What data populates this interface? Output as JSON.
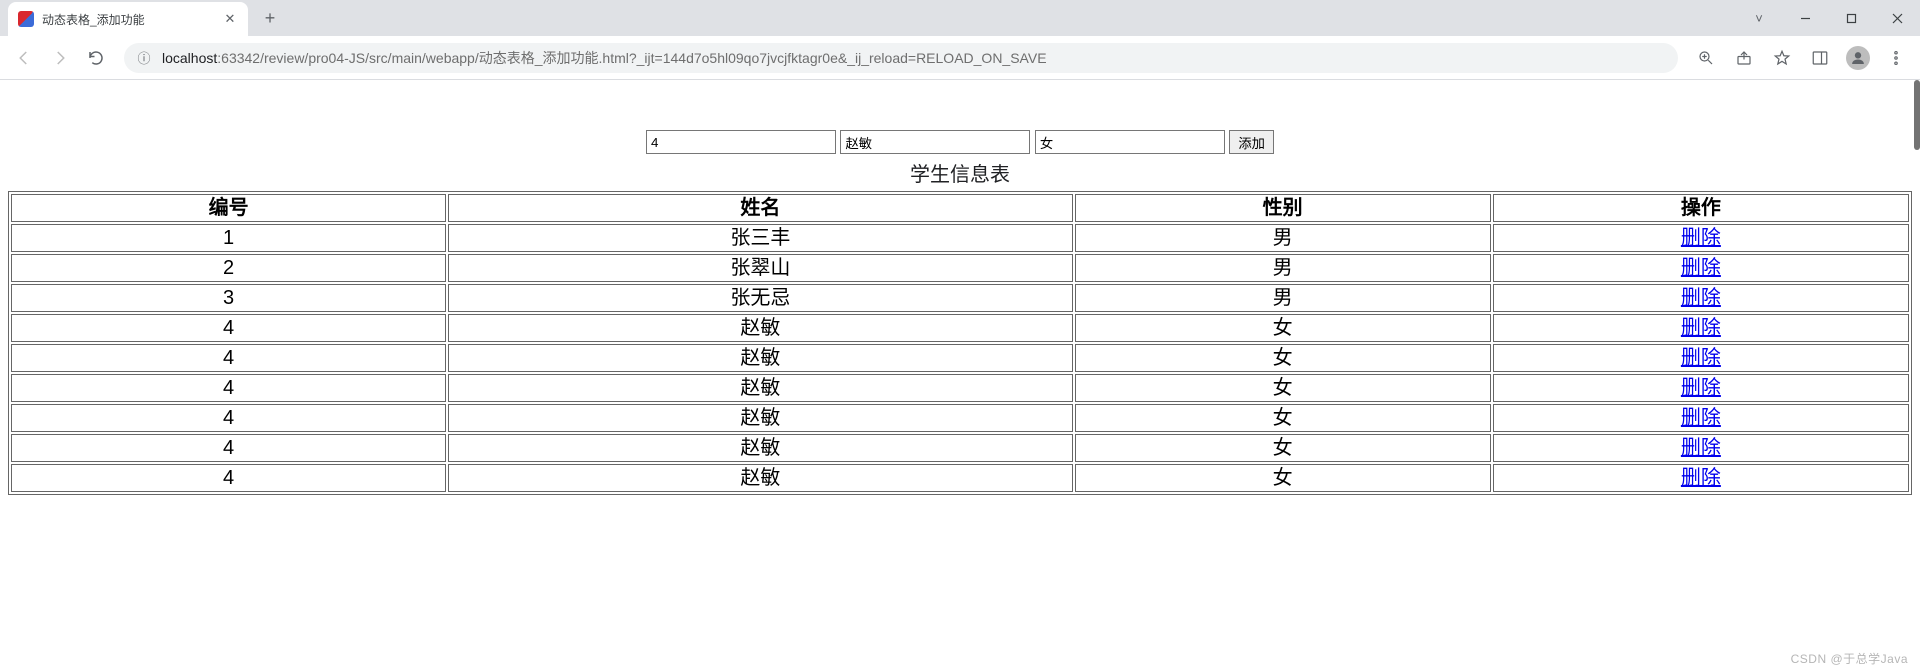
{
  "browser": {
    "tab_title": "动态表格_添加功能",
    "url_host": "localhost",
    "url_port_path": ":63342/review/pro04-JS/src/main/webapp/动态表格_添加功能.html?_ijt=144d7o5hl09qo7jvcjfktagr0e&_ij_reload=RELOAD_ON_SAVE"
  },
  "form": {
    "id_value": "4",
    "name_value": "赵敏",
    "gender_value": "女",
    "add_label": "添加"
  },
  "table": {
    "caption": "学生信息表",
    "headers": [
      "编号",
      "姓名",
      "性别",
      "操作"
    ],
    "delete_label": "删除",
    "rows": [
      {
        "id": "1",
        "name": "张三丰",
        "gender": "男"
      },
      {
        "id": "2",
        "name": "张翠山",
        "gender": "男"
      },
      {
        "id": "3",
        "name": "张无忌",
        "gender": "男"
      },
      {
        "id": "4",
        "name": "赵敏",
        "gender": "女"
      },
      {
        "id": "4",
        "name": "赵敏",
        "gender": "女"
      },
      {
        "id": "4",
        "name": "赵敏",
        "gender": "女"
      },
      {
        "id": "4",
        "name": "赵敏",
        "gender": "女"
      },
      {
        "id": "4",
        "name": "赵敏",
        "gender": "女"
      },
      {
        "id": "4",
        "name": "赵敏",
        "gender": "女"
      }
    ]
  },
  "watermark": "CSDN @于总学Java"
}
